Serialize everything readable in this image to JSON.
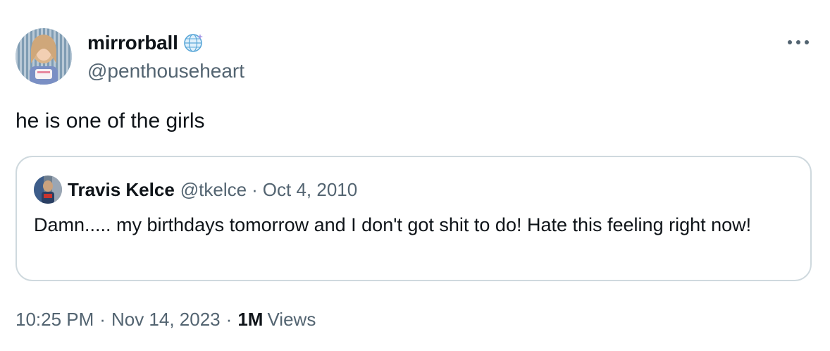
{
  "author": {
    "display_name": "mirrorball",
    "handle": "@penthouseheart",
    "avatar_icon": "profile-photo-icon",
    "badge_icon": "disco-globe-icon"
  },
  "menu": {
    "icon": "more-options-icon"
  },
  "tweet": {
    "text": "he is one of the girls"
  },
  "quoted": {
    "display_name": "Travis Kelce",
    "handle": "@tkelce",
    "separator": "·",
    "date": "Oct 4, 2010",
    "text": "Damn..... my birthdays tomorrow and I don't got shit to do! Hate this feeling right now!",
    "avatar_icon": "profile-photo-icon"
  },
  "meta": {
    "time": "10:25 PM",
    "separator": "·",
    "date": "Nov 14, 2023",
    "views_count": "1M",
    "views_label": "Views"
  },
  "colors": {
    "text_primary": "#0f1419",
    "text_secondary": "#536471",
    "border": "#cfd9de"
  }
}
